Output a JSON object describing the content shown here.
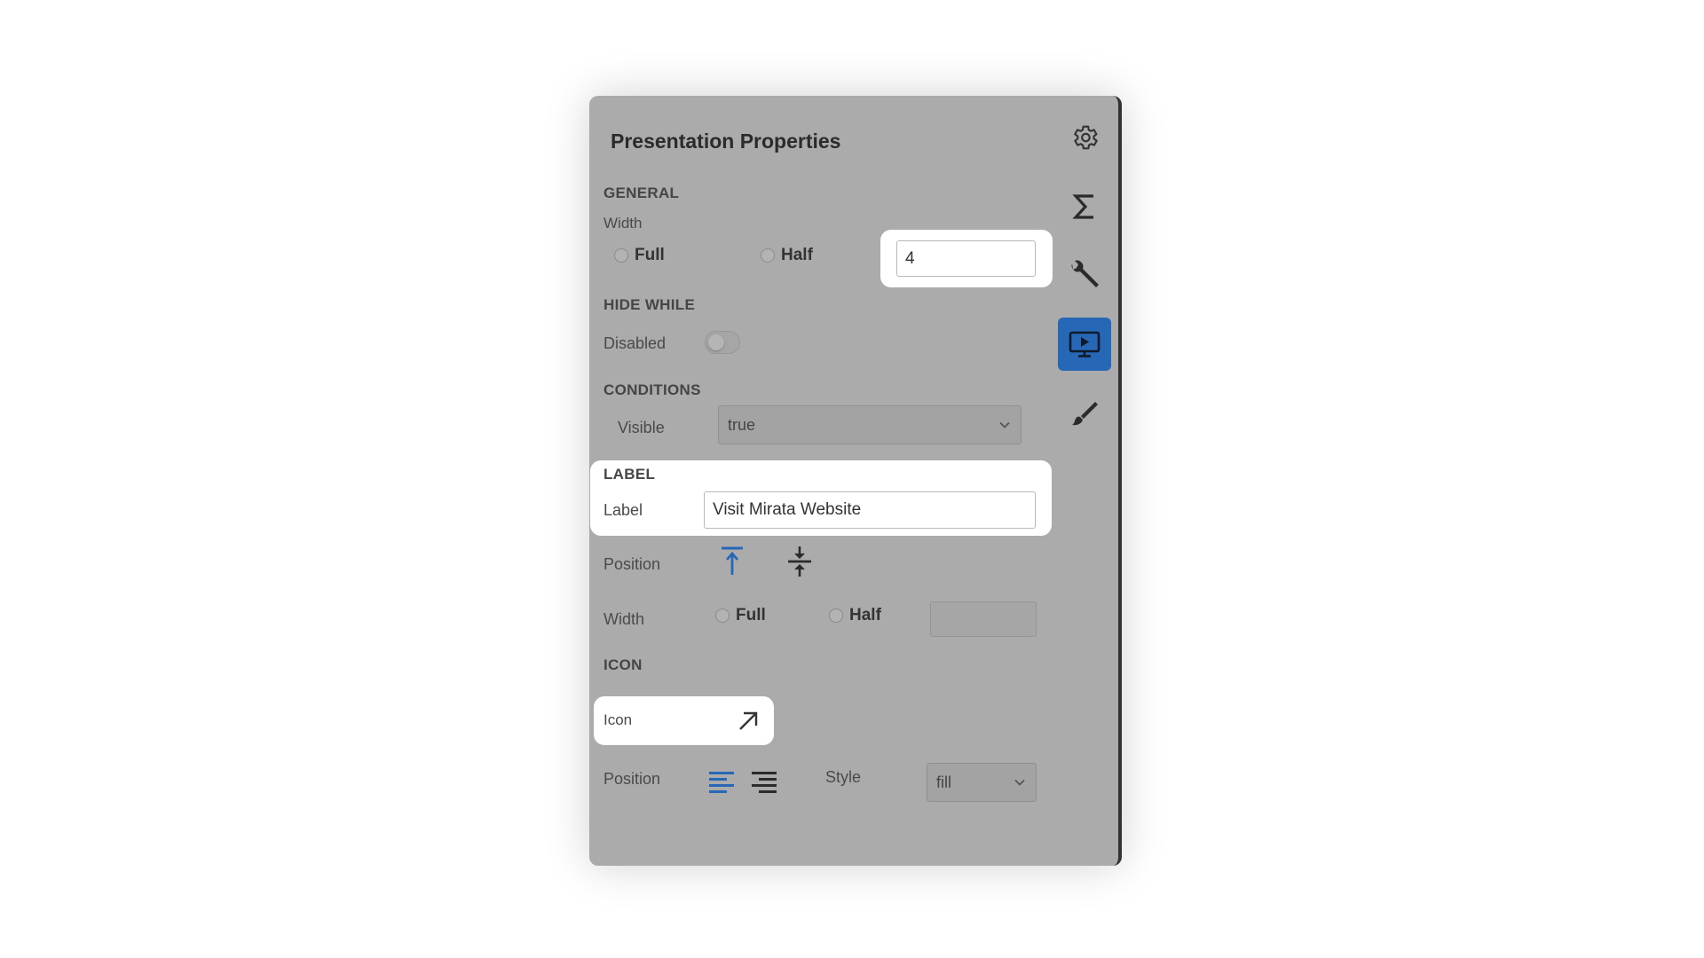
{
  "panel": {
    "title": "Presentation Properties",
    "colors": {
      "accent": "#2668b5",
      "panel_bg": "#ababab",
      "highlight": "#ffffff"
    }
  },
  "general": {
    "heading": "GENERAL",
    "width_label": "Width",
    "option_full": "Full",
    "option_half": "Half",
    "width_value": "4"
  },
  "hide_while": {
    "heading": "HIDE WHILE",
    "disabled_label": "Disabled",
    "disabled_on": false
  },
  "conditions": {
    "heading": "CONDITIONS",
    "visible_label": "Visible",
    "visible_value": "true"
  },
  "label_section": {
    "heading": "LABEL",
    "label_label": "Label",
    "label_value": "Visit Mirata Website",
    "position_label": "Position",
    "width_label": "Width",
    "option_full": "Full",
    "option_half": "Half",
    "width_value": ""
  },
  "icon_section": {
    "heading": "ICON",
    "icon_label": "Icon",
    "icon_name": "arrow-up-right-icon",
    "position_label": "Position",
    "style_label": "Style",
    "style_value": "fill"
  },
  "sidebar": {
    "items": [
      {
        "icon": "gear-icon",
        "active": false
      },
      {
        "icon": "sigma-icon",
        "active": false
      },
      {
        "icon": "wrench-icon",
        "active": false
      },
      {
        "icon": "presentation-icon",
        "active": true
      },
      {
        "icon": "brush-icon",
        "active": false
      }
    ]
  }
}
